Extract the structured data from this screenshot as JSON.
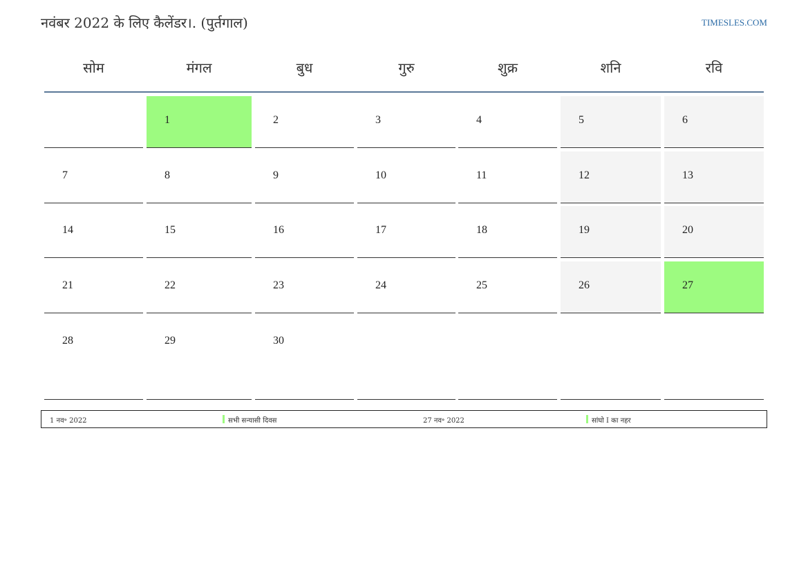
{
  "header": {
    "title": "नवंबर 2022 के लिए कैलेंडर।. (पुर्तगाल)",
    "site": "TIMESLES.COM"
  },
  "weekdays": [
    "सोम",
    "मंगल",
    "बुध",
    "गुरु",
    "शुक्र",
    "शनि",
    "रवि"
  ],
  "weeks": [
    [
      "",
      "1",
      "2",
      "3",
      "4",
      "5",
      "6"
    ],
    [
      "7",
      "8",
      "9",
      "10",
      "11",
      "12",
      "13"
    ],
    [
      "14",
      "15",
      "16",
      "17",
      "18",
      "19",
      "20"
    ],
    [
      "21",
      "22",
      "23",
      "24",
      "25",
      "26",
      "27"
    ],
    [
      "28",
      "29",
      "30",
      "",
      "",
      "",
      ""
    ]
  ],
  "holidays": [
    "1",
    "27"
  ],
  "legend": [
    {
      "date": "1 नव॰ 2022",
      "name": "सभी सन्यासी दिवस"
    },
    {
      "date": "27 नव॰ 2022",
      "name": "सांघो I का नहर"
    }
  ],
  "colors": {
    "holiday": "#9dfb80",
    "weekend": "#f4f4f4",
    "rule": "#5a7898",
    "link": "#2a6aa6"
  }
}
